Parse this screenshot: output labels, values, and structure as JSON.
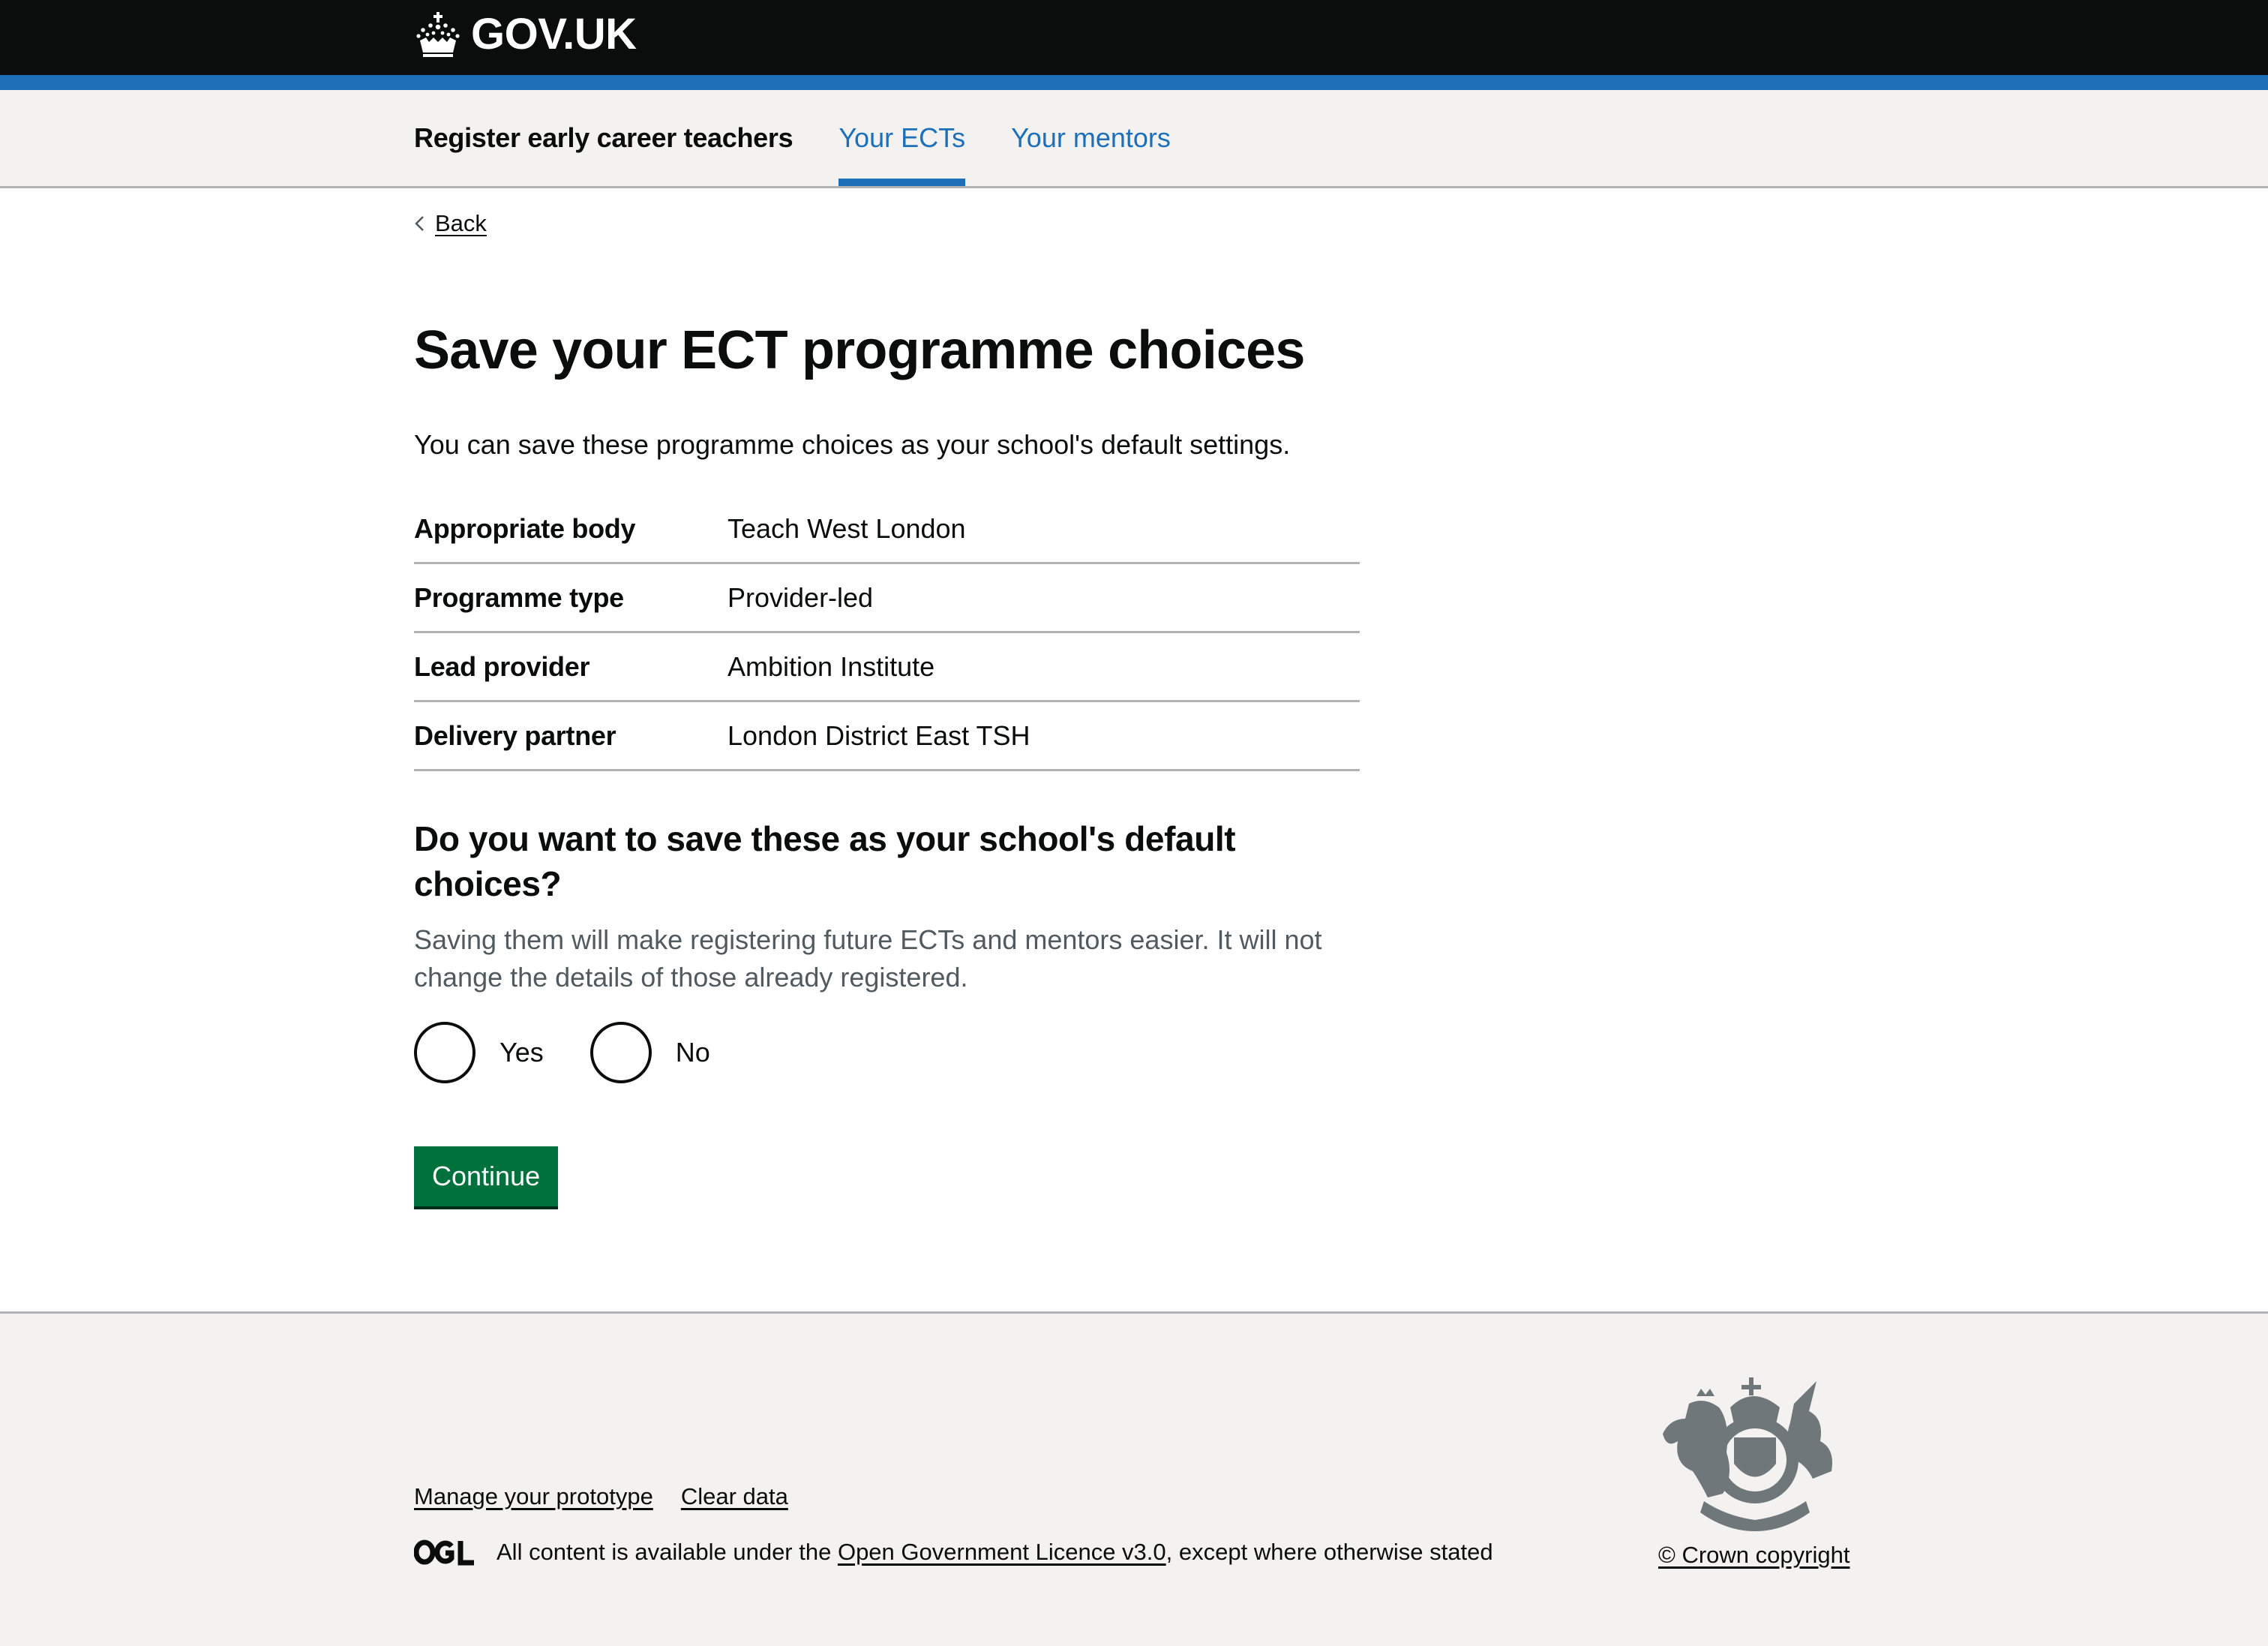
{
  "header": {
    "logo_text": "GOV.UK",
    "logo_icon": "crown-icon"
  },
  "service_nav": {
    "service_name": "Register early career teachers",
    "items": [
      {
        "label": "Your ECTs",
        "active": true
      },
      {
        "label": "Your mentors",
        "active": false
      }
    ]
  },
  "back_link": {
    "label": "Back"
  },
  "main": {
    "title": "Save your ECT programme choices",
    "lede": "You can save these programme choices as your school's default settings.",
    "summary": [
      {
        "key": "Appropriate body",
        "value": "Teach West London"
      },
      {
        "key": "Programme type",
        "value": "Provider-led"
      },
      {
        "key": "Lead provider",
        "value": "Ambition Institute"
      },
      {
        "key": "Delivery partner",
        "value": "London District East TSH"
      }
    ],
    "question": "Do you want to save these as your school's default choices?",
    "hint": "Saving them will make registering future ECTs and mentors easier. It will not change the details of those already registered.",
    "radios": [
      {
        "label": "Yes",
        "checked": false
      },
      {
        "label": "No",
        "checked": false
      }
    ],
    "continue_label": "Continue"
  },
  "footer": {
    "links": [
      "Manage your prototype",
      "Clear data"
    ],
    "licence_prefix": "All content is available under the ",
    "licence_link": "Open Government Licence v3.0",
    "licence_suffix": ", except where otherwise stated",
    "ogl_icon": "ogl-logo-icon",
    "crest_icon": "royal-coat-of-arms-icon",
    "copyright": "© Crown copyright"
  },
  "colors": {
    "header_bg": "#0b0c0c",
    "brand_blue": "#1d70b8",
    "nav_bg": "#f3f2f1",
    "button_green": "#00703c",
    "hint_grey": "#505a5f",
    "crest_grey": "#6f777b"
  }
}
